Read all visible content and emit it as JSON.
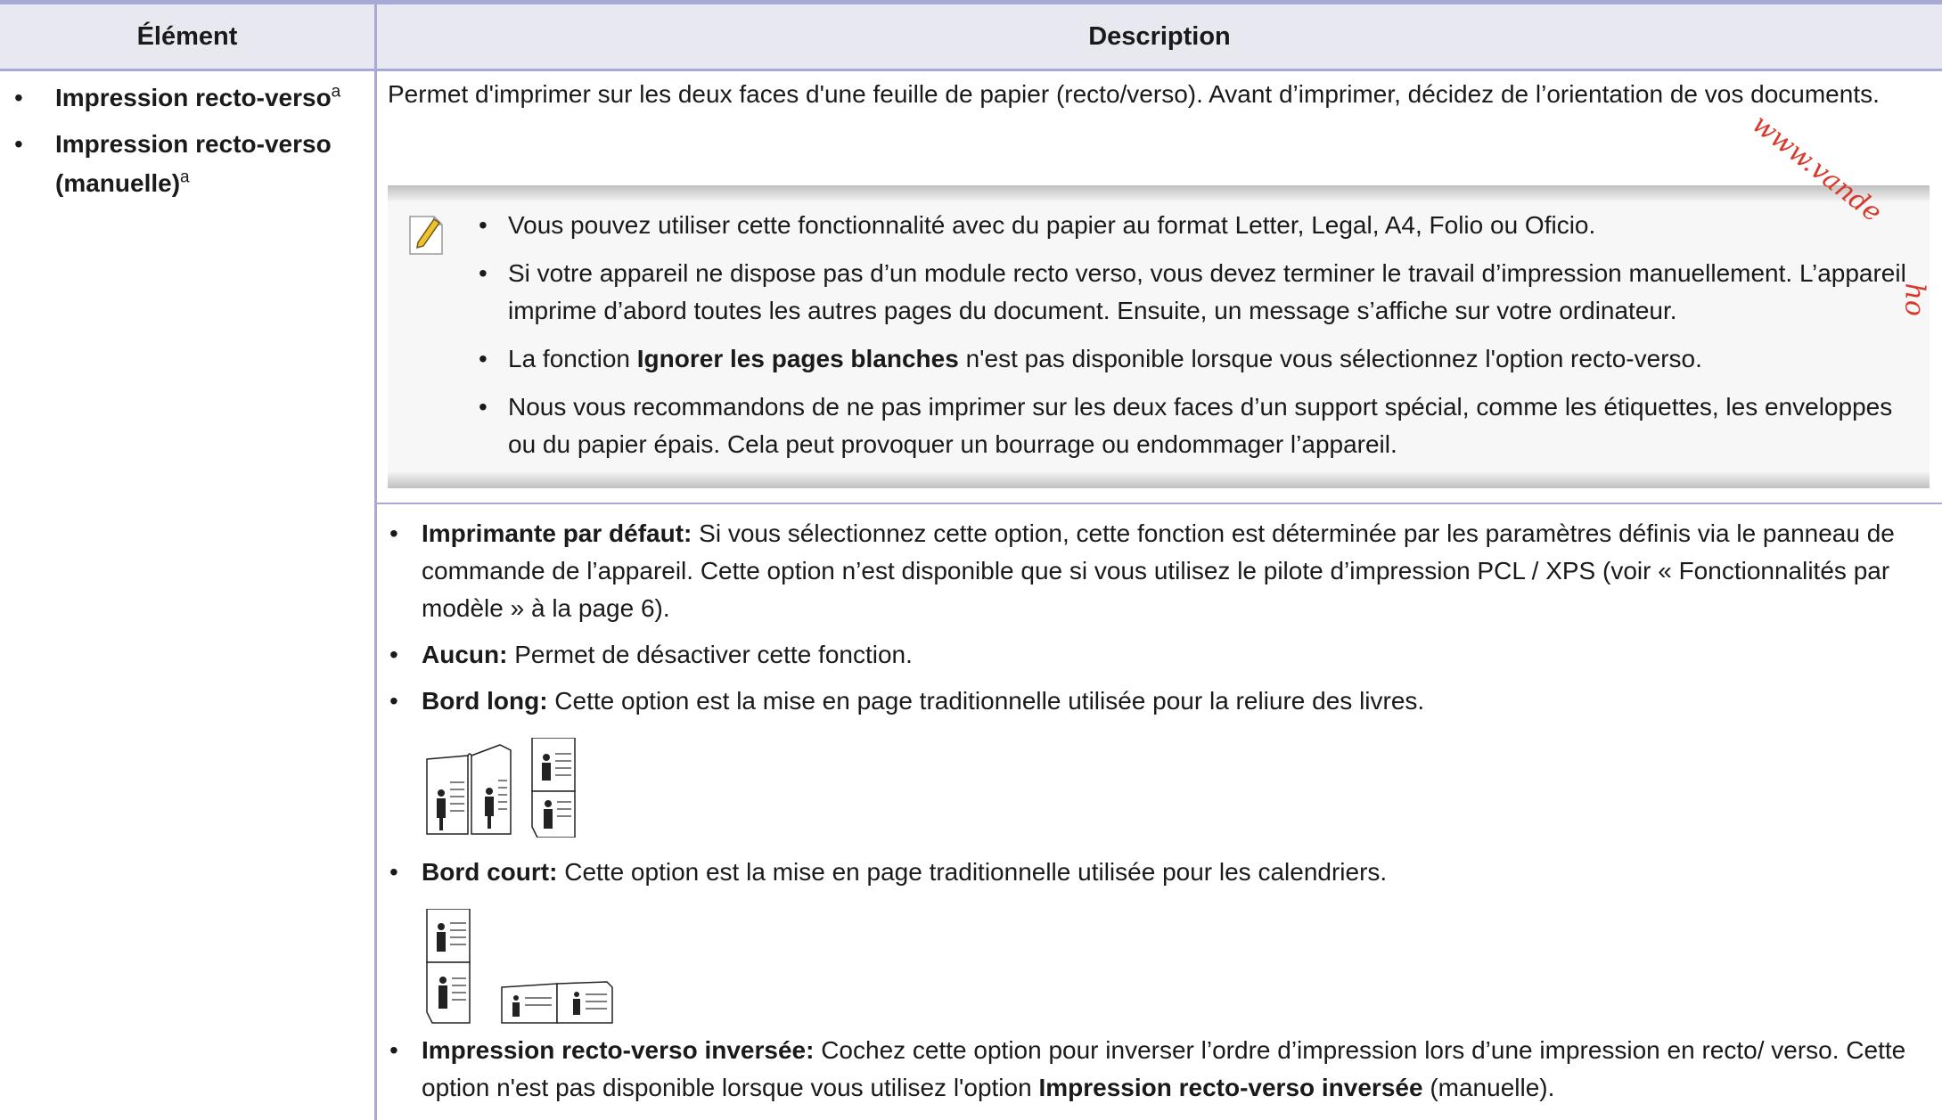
{
  "table": {
    "header": {
      "col1": "Élément",
      "col2": "Description"
    },
    "left_items": [
      {
        "label": "Impression recto-verso",
        "sup": "a"
      },
      {
        "label": "Impression recto-verso (manuelle)",
        "sup": "a"
      }
    ]
  },
  "intro": "Permet d'imprimer sur les deux faces d'une feuille de papier (recto/verso). Avant d’imprimer, décidez de l’orientation de vos documents.",
  "note": {
    "icon": "note-pencil-icon",
    "items": {
      "n1": "Vous pouvez utiliser cette fonctionnalité avec du papier au format Letter, Legal, A4, Folio ou Oficio.",
      "n2": "Si votre appareil ne dispose pas d’un module recto verso, vous devez terminer le travail d’impression manuellement. L’appareil imprime d’abord toutes les autres pages du document. Ensuite, un message s’affiche sur votre ordinateur.",
      "n3_pre": "La fonction ",
      "n3_bold": "Ignorer les pages blanches",
      "n3_post": " n'est pas disponible lorsque vous sélectionnez l'option recto-verso.",
      "n4": "Nous vous recommandons de ne pas imprimer sur les deux faces d’un support spécial, comme les étiquettes, les enveloppes ou du papier épais. Cela peut provoquer un bourrage ou endommager l’appareil."
    }
  },
  "options": {
    "o1_bold": "Imprimante par défaut:",
    "o1_text": " Si vous sélectionnez cette option, cette fonction est déterminée par les paramètres définis via le panneau de commande de l’appareil. Cette option n’est disponible que si vous utilisez le pilote d’impression PCL / XPS (voir « Fonctionnalités par modèle » à la page 6).",
    "o2_bold": "Aucun:",
    "o2_text": " Permet de désactiver cette fonction.",
    "o3_bold": "Bord long:",
    "o3_text": " Cette option est la mise en page traditionnelle utilisée pour la reliure des livres.",
    "o4_bold": "Bord court:",
    "o4_text": " Cette option est la mise en page traditionnelle utilisée pour les calendriers.",
    "o5_bold": "Impression recto-verso inversée:",
    "o5_text": " Cochez cette option pour inverser l’ordre d’impression lors d’une impression en recto/ verso. Cette option n'est pas disponible lorsque vous utilisez l'option ",
    "o5_bold2": "Impression recto-verso inversée",
    "o5_tail": " (manuelle)."
  },
  "watermark": {
    "text": "www.vande",
    "text2": "ho",
    "color": "#d93a2b"
  }
}
